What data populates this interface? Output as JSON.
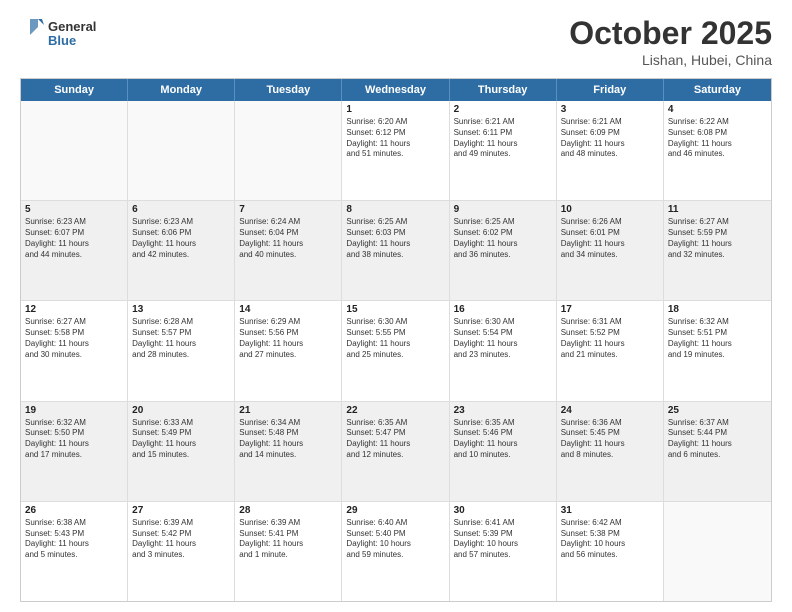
{
  "header": {
    "logo_general": "General",
    "logo_blue": "Blue",
    "month_title": "October 2025",
    "location": "Lishan, Hubei, China"
  },
  "weekdays": [
    "Sunday",
    "Monday",
    "Tuesday",
    "Wednesday",
    "Thursday",
    "Friday",
    "Saturday"
  ],
  "weeks": [
    [
      {
        "day": "",
        "text": "",
        "empty": true
      },
      {
        "day": "",
        "text": "",
        "empty": true
      },
      {
        "day": "",
        "text": "",
        "empty": true
      },
      {
        "day": "1",
        "text": "Sunrise: 6:20 AM\nSunset: 6:12 PM\nDaylight: 11 hours\nand 51 minutes."
      },
      {
        "day": "2",
        "text": "Sunrise: 6:21 AM\nSunset: 6:11 PM\nDaylight: 11 hours\nand 49 minutes."
      },
      {
        "day": "3",
        "text": "Sunrise: 6:21 AM\nSunset: 6:09 PM\nDaylight: 11 hours\nand 48 minutes."
      },
      {
        "day": "4",
        "text": "Sunrise: 6:22 AM\nSunset: 6:08 PM\nDaylight: 11 hours\nand 46 minutes."
      }
    ],
    [
      {
        "day": "5",
        "text": "Sunrise: 6:23 AM\nSunset: 6:07 PM\nDaylight: 11 hours\nand 44 minutes."
      },
      {
        "day": "6",
        "text": "Sunrise: 6:23 AM\nSunset: 6:06 PM\nDaylight: 11 hours\nand 42 minutes."
      },
      {
        "day": "7",
        "text": "Sunrise: 6:24 AM\nSunset: 6:04 PM\nDaylight: 11 hours\nand 40 minutes."
      },
      {
        "day": "8",
        "text": "Sunrise: 6:25 AM\nSunset: 6:03 PM\nDaylight: 11 hours\nand 38 minutes."
      },
      {
        "day": "9",
        "text": "Sunrise: 6:25 AM\nSunset: 6:02 PM\nDaylight: 11 hours\nand 36 minutes."
      },
      {
        "day": "10",
        "text": "Sunrise: 6:26 AM\nSunset: 6:01 PM\nDaylight: 11 hours\nand 34 minutes."
      },
      {
        "day": "11",
        "text": "Sunrise: 6:27 AM\nSunset: 5:59 PM\nDaylight: 11 hours\nand 32 minutes."
      }
    ],
    [
      {
        "day": "12",
        "text": "Sunrise: 6:27 AM\nSunset: 5:58 PM\nDaylight: 11 hours\nand 30 minutes."
      },
      {
        "day": "13",
        "text": "Sunrise: 6:28 AM\nSunset: 5:57 PM\nDaylight: 11 hours\nand 28 minutes."
      },
      {
        "day": "14",
        "text": "Sunrise: 6:29 AM\nSunset: 5:56 PM\nDaylight: 11 hours\nand 27 minutes."
      },
      {
        "day": "15",
        "text": "Sunrise: 6:30 AM\nSunset: 5:55 PM\nDaylight: 11 hours\nand 25 minutes."
      },
      {
        "day": "16",
        "text": "Sunrise: 6:30 AM\nSunset: 5:54 PM\nDaylight: 11 hours\nand 23 minutes."
      },
      {
        "day": "17",
        "text": "Sunrise: 6:31 AM\nSunset: 5:52 PM\nDaylight: 11 hours\nand 21 minutes."
      },
      {
        "day": "18",
        "text": "Sunrise: 6:32 AM\nSunset: 5:51 PM\nDaylight: 11 hours\nand 19 minutes."
      }
    ],
    [
      {
        "day": "19",
        "text": "Sunrise: 6:32 AM\nSunset: 5:50 PM\nDaylight: 11 hours\nand 17 minutes."
      },
      {
        "day": "20",
        "text": "Sunrise: 6:33 AM\nSunset: 5:49 PM\nDaylight: 11 hours\nand 15 minutes."
      },
      {
        "day": "21",
        "text": "Sunrise: 6:34 AM\nSunset: 5:48 PM\nDaylight: 11 hours\nand 14 minutes."
      },
      {
        "day": "22",
        "text": "Sunrise: 6:35 AM\nSunset: 5:47 PM\nDaylight: 11 hours\nand 12 minutes."
      },
      {
        "day": "23",
        "text": "Sunrise: 6:35 AM\nSunset: 5:46 PM\nDaylight: 11 hours\nand 10 minutes."
      },
      {
        "day": "24",
        "text": "Sunrise: 6:36 AM\nSunset: 5:45 PM\nDaylight: 11 hours\nand 8 minutes."
      },
      {
        "day": "25",
        "text": "Sunrise: 6:37 AM\nSunset: 5:44 PM\nDaylight: 11 hours\nand 6 minutes."
      }
    ],
    [
      {
        "day": "26",
        "text": "Sunrise: 6:38 AM\nSunset: 5:43 PM\nDaylight: 11 hours\nand 5 minutes."
      },
      {
        "day": "27",
        "text": "Sunrise: 6:39 AM\nSunset: 5:42 PM\nDaylight: 11 hours\nand 3 minutes."
      },
      {
        "day": "28",
        "text": "Sunrise: 6:39 AM\nSunset: 5:41 PM\nDaylight: 11 hours\nand 1 minute."
      },
      {
        "day": "29",
        "text": "Sunrise: 6:40 AM\nSunset: 5:40 PM\nDaylight: 10 hours\nand 59 minutes."
      },
      {
        "day": "30",
        "text": "Sunrise: 6:41 AM\nSunset: 5:39 PM\nDaylight: 10 hours\nand 57 minutes."
      },
      {
        "day": "31",
        "text": "Sunrise: 6:42 AM\nSunset: 5:38 PM\nDaylight: 10 hours\nand 56 minutes."
      },
      {
        "day": "",
        "text": "",
        "empty": true
      }
    ]
  ]
}
